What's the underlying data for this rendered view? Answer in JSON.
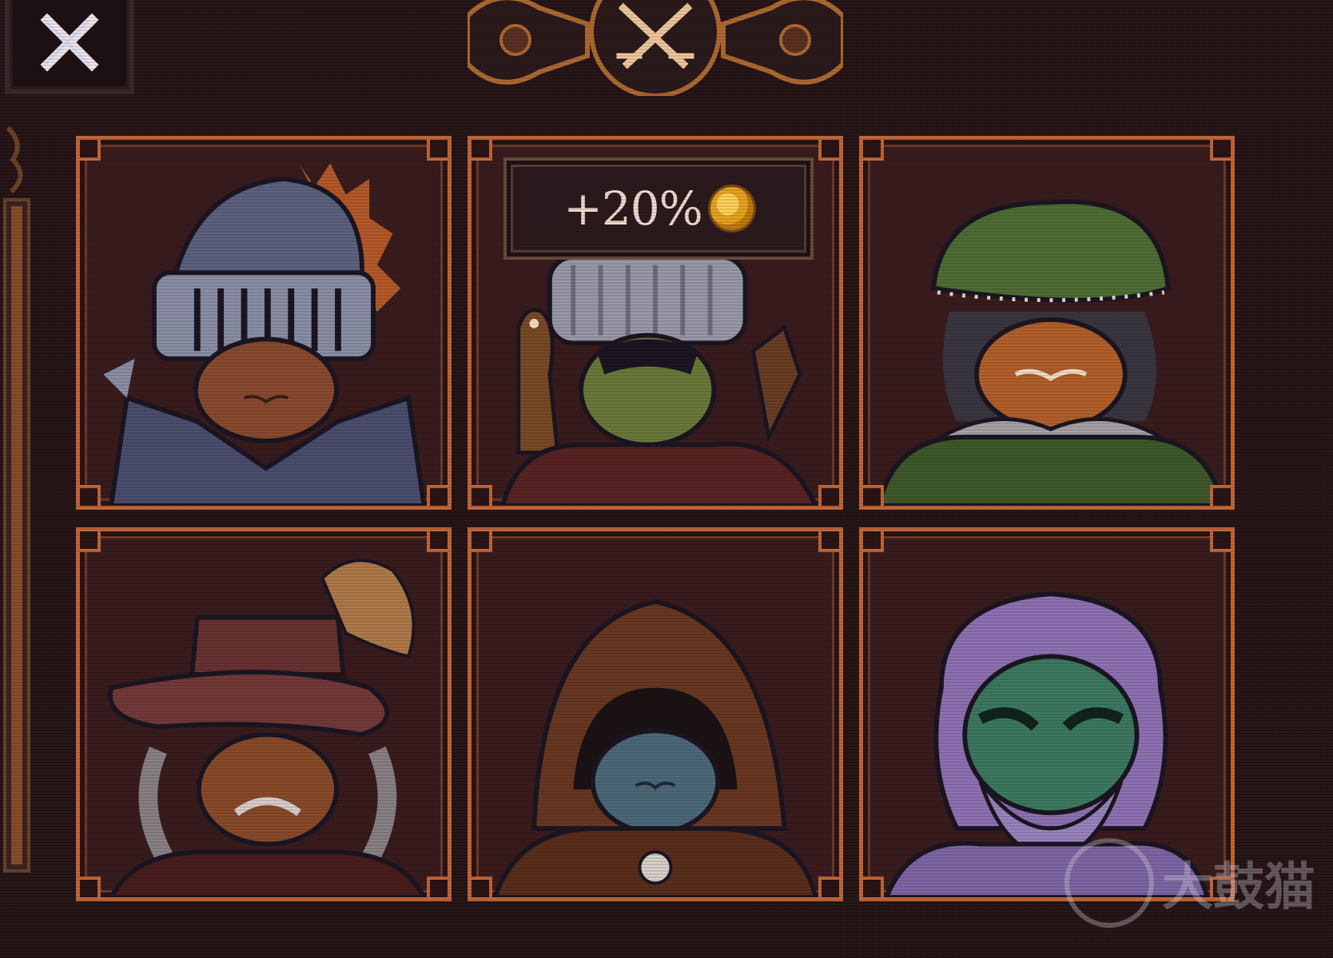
{
  "close_button": {
    "icon": "close-x-icon"
  },
  "emblem": {
    "icon": "crossed-swords-icon"
  },
  "characters": [
    {
      "id": "knight",
      "icon": "knight-helmet-portrait"
    },
    {
      "id": "falconer",
      "icon": "falconer-portrait",
      "bonus": {
        "text": "+20%",
        "icon": "gold-coin-icon"
      }
    },
    {
      "id": "noble",
      "icon": "green-beret-noble-portrait"
    },
    {
      "id": "musketeer",
      "icon": "musketeer-hat-portrait"
    },
    {
      "id": "hooded",
      "icon": "hooded-cloak-portrait"
    },
    {
      "id": "sage",
      "icon": "lilac-haired-sage-portrait"
    }
  ],
  "watermark": {
    "text": "大鼓猫"
  },
  "colors": {
    "frame": "#c4683a",
    "background": "#2a1719",
    "card": "#3a1c1e"
  }
}
